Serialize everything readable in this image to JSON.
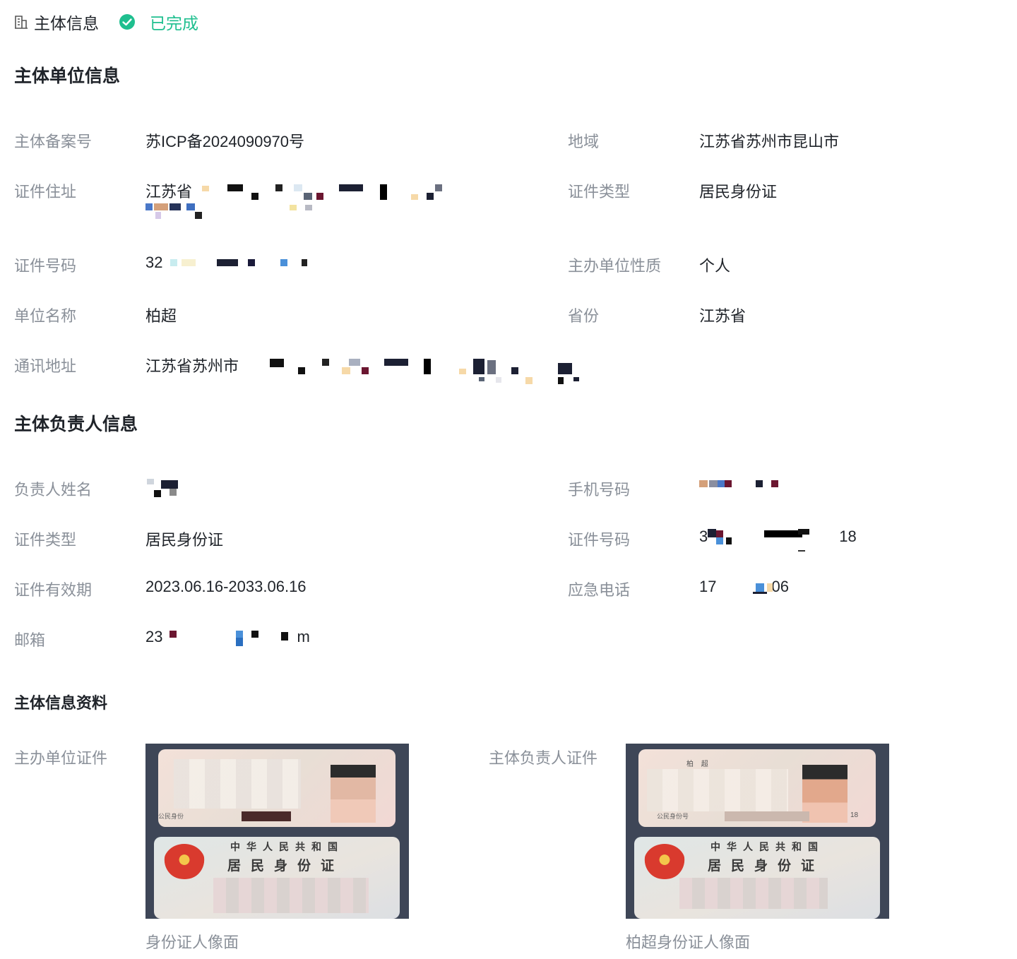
{
  "header": {
    "title": "主体信息",
    "status": "已完成",
    "status_color": "#1fbf8f"
  },
  "org_section": {
    "title": "主体单位信息",
    "fields": {
      "record_no": {
        "label": "主体备案号",
        "value": "苏ICP备2024090970号"
      },
      "region": {
        "label": "地域",
        "value": "江苏省苏州市昆山市"
      },
      "cert_address": {
        "label": "证件住址",
        "value_prefix": "江苏省"
      },
      "cert_type": {
        "label": "证件类型",
        "value": "居民身份证"
      },
      "cert_no": {
        "label": "证件号码",
        "value_prefix": "32"
      },
      "org_nature": {
        "label": "主办单位性质",
        "value": "个人"
      },
      "org_name": {
        "label": "单位名称",
        "value": "柏超"
      },
      "province": {
        "label": "省份",
        "value": "江苏省"
      },
      "mail_address": {
        "label": "通讯地址",
        "value_prefix": "江苏省苏州市"
      }
    }
  },
  "person_section": {
    "title": "主体负责人信息",
    "fields": {
      "name": {
        "label": "负责人姓名"
      },
      "phone": {
        "label": "手机号码"
      },
      "cert_type": {
        "label": "证件类型",
        "value": "居民身份证"
      },
      "cert_no": {
        "label": "证件号码",
        "value_prefix": "3",
        "value_suffix": "18"
      },
      "validity": {
        "label": "证件有效期",
        "value": "2023.06.16-2033.06.16"
      },
      "emergency": {
        "label": "应急电话",
        "value_prefix": "17",
        "value_suffix": "06"
      },
      "email": {
        "label": "邮箱",
        "value_prefix": "23",
        "value_suffix": "m"
      }
    }
  },
  "docs_section": {
    "title": "主体信息资料",
    "org_doc": {
      "label": "主办单位证件",
      "caption": "身份证人像面",
      "card_line1": "中华人民共和国",
      "card_line2": "居民身份证",
      "card_small": "公民身份"
    },
    "person_doc": {
      "label": "主体负责人证件",
      "caption": "柏超身份证人像面",
      "card_line1": "中华人民共和国",
      "card_line2": "居民身份证",
      "card_small": "公民身份号",
      "card_name": "柏 超",
      "card_tail": "18"
    }
  }
}
